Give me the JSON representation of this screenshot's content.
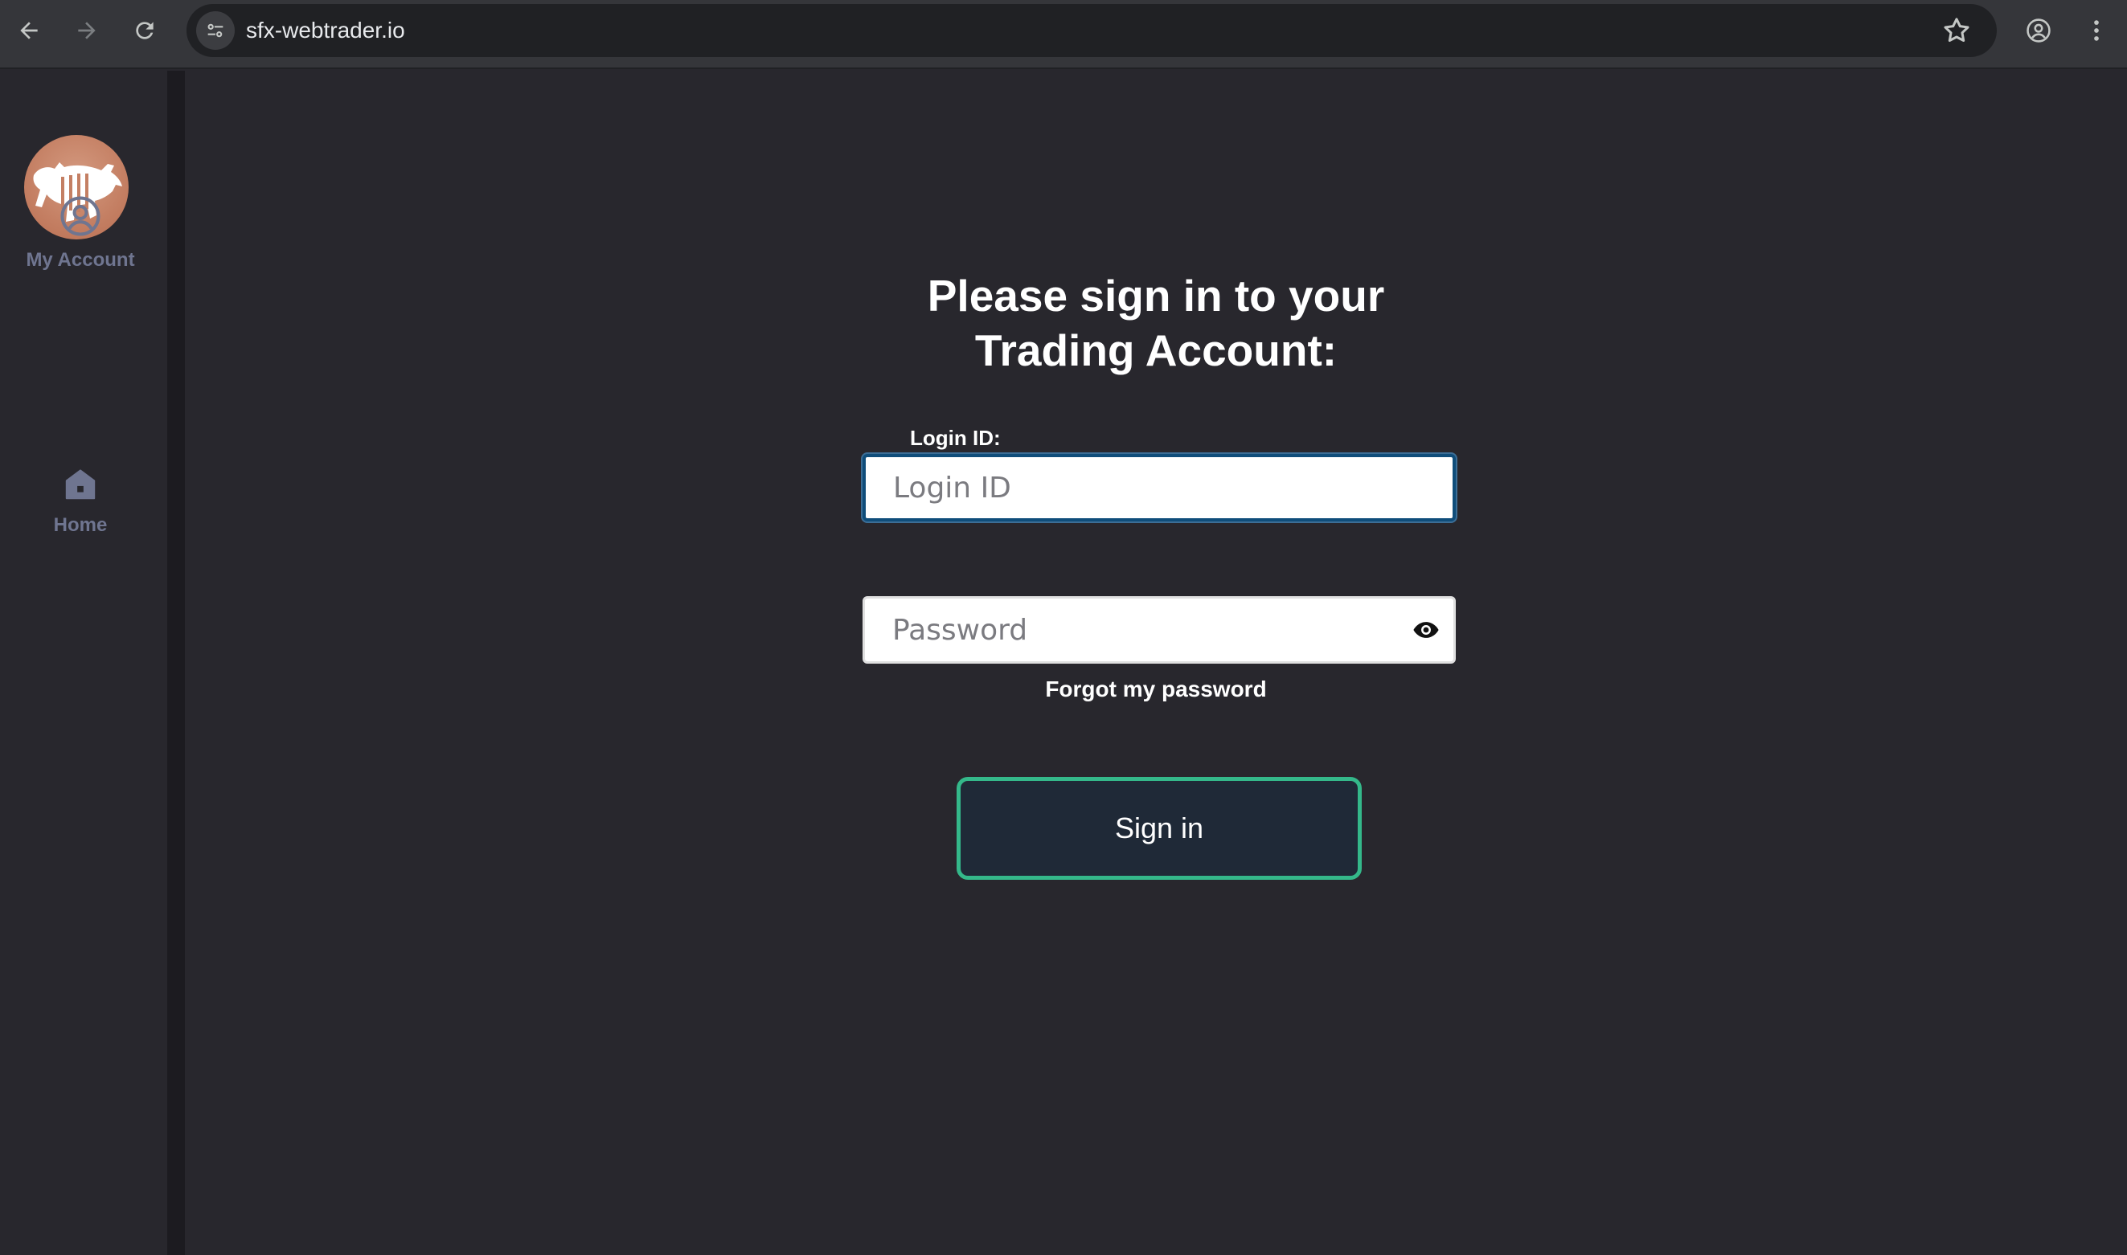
{
  "browser": {
    "url": "sfx-webtrader.io",
    "back_icon": "back-arrow-icon",
    "forward_icon": "forward-arrow-icon",
    "reload_icon": "reload-icon",
    "bookmark_icon": "star-icon",
    "profile_icon": "profile-icon",
    "menu_icon": "kebab-menu-icon"
  },
  "sidebar": {
    "logo": "bull-logo",
    "items": [
      {
        "label": "My Account",
        "icon": "user-circle-icon"
      },
      {
        "label": "Home",
        "icon": "home-icon"
      }
    ]
  },
  "main": {
    "title_line1": "Please sign in to your",
    "title_line2": "Trading Account:",
    "login_label": "Login ID:",
    "login_placeholder": "Login ID",
    "login_value": "",
    "password_placeholder": "Password",
    "password_value": "",
    "show_password_icon": "eye-icon",
    "forgot_password": "Forgot my password",
    "signin_button": "Sign in"
  },
  "colors": {
    "background": "#28272d",
    "sidebar_text": "#6f7590",
    "button_bg": "#1f2937",
    "button_border": "#34b88a",
    "logo": "#c47f63"
  }
}
